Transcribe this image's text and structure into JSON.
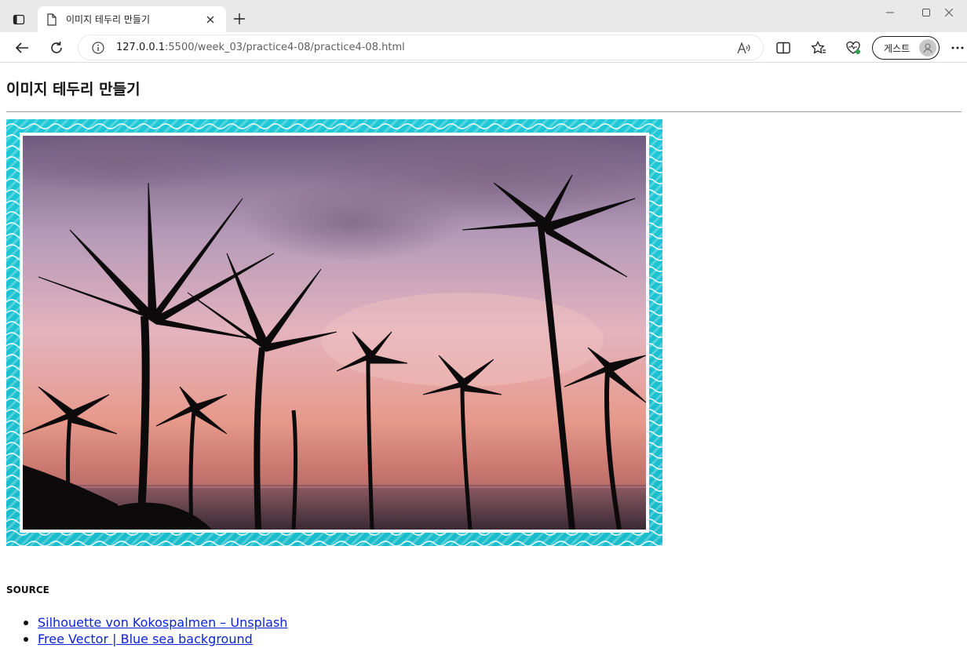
{
  "browser": {
    "tab_title": "이미지 테두리 만들기",
    "url_host": "127.0.0.1",
    "url_rest": ":5500/week_03/practice4-08/practice4-08.html",
    "profile_label": "게스트"
  },
  "page": {
    "heading": "이미지 테두리 만들기",
    "image_alt": "Silhouette of palm trees at sunset over the sea",
    "source_title": "SOURCE",
    "links": [
      {
        "label": "Silhouette von Kokospalmen – Unsplash"
      },
      {
        "label": "Free Vector | Blue sea background"
      }
    ]
  },
  "colors": {
    "frame": "#1fc8d6",
    "link": "#0b23d9"
  }
}
